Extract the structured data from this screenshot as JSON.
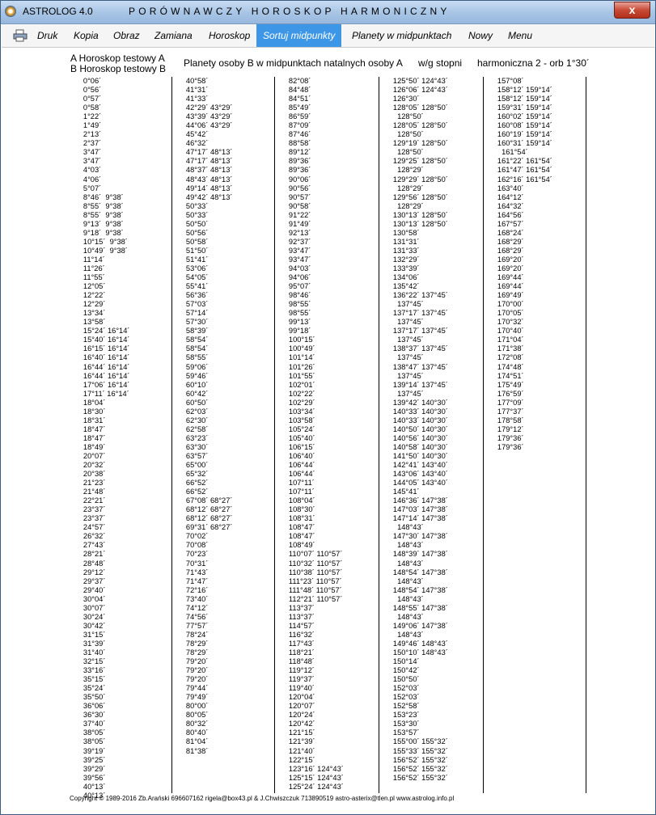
{
  "window": {
    "app_title": "ASTROLOG 4.0",
    "doc_title": "PORÓWNAWCZY HOROSKOP HARMONICZNY",
    "close_label": "x"
  },
  "menu": {
    "items": [
      "Druk",
      "Kopia",
      "Obraz",
      "Zamiana",
      "Horoskop",
      "Sortuj midpunkty",
      "Planety w midpunktach",
      "Nowy",
      "Menu"
    ],
    "active": "Sortuj midpunkty"
  },
  "header": {
    "chart_a": "A Horoskop testowy A",
    "chart_b": "B Horoskop testowy B",
    "description": "Planety osoby B w midpunktach natalnych osoby A",
    "sort": "w/g stopni",
    "harmonic": "harmoniczna 2 - orb 1°30´"
  },
  "columns": {
    "c1": [
      "0°06´",
      "0°56´",
      "0°57´",
      "0°58´",
      "1°22´",
      "1°49´",
      "2°13´",
      "2°37´",
      "3°47´",
      "3°47´",
      "4°03´",
      "4°06´",
      "5°07´",
      "8°46´  9°38´",
      "8°55´  9°38´",
      "8°55´  9°38´",
      "9°13´  9°38´",
      "9°18´  9°38´",
      "10°15´  9°38´",
      "10°49´  9°38´",
      "11°14´",
      "11°26´",
      "11°55´",
      "12°05´",
      "12°22´",
      "12°29´",
      "13°34´",
      "13°58´",
      "15°24´ 16°14´",
      "15°40´ 16°14´",
      "16°15´ 16°14´",
      "16°40´ 16°14´",
      "16°44´ 16°14´",
      "16°44´ 16°14´",
      "17°06´ 16°14´",
      "17°11´ 16°14´",
      "18°04´",
      "18°30´",
      "18°31´",
      "18°47´",
      "18°47´",
      "18°49´",
      "20°07´",
      "20°32´",
      "20°38´",
      "21°23´",
      "21°48´",
      "22°21´",
      "23°37´",
      "23°37´",
      "24°57´",
      "26°32´",
      "27°43´",
      "28°21´",
      "28°48´",
      "29°12´",
      "29°37´",
      "29°40´",
      "30°04´",
      "30°07´",
      "30°24´",
      "30°42´",
      "31°15´",
      "31°39´",
      "31°40´",
      "32°15´",
      "33°16´",
      "35°15´",
      "35°24´",
      "35°50´",
      "36°06´",
      "36°30´",
      "37°40´",
      "38°05´",
      "38°05´",
      "39°19´",
      "39°25´",
      "39°29´",
      "39°56´",
      "40°13´",
      "40°13´"
    ],
    "c2": [
      "40°58´",
      "41°31´",
      "41°33´",
      "42°29´ 43°29´",
      "43°39´ 43°29´",
      "44°06´ 43°29´",
      "45°42´",
      "46°32´",
      "47°17´ 48°13´",
      "47°17´ 48°13´",
      "48°37´ 48°13´",
      "48°43´ 48°13´",
      "49°14´ 48°13´",
      "49°42´ 48°13´",
      "50°33´",
      "50°33´",
      "50°50´",
      "50°56´",
      "50°58´",
      "51°50´",
      "51°41´",
      "53°06´",
      "54°05´",
      "55°41´",
      "56°36´",
      "57°03´",
      "57°14´",
      "57°30´",
      "58°39´",
      "58°54´",
      "58°54´",
      "58°55´",
      "59°06´",
      "59°46´",
      "60°10´",
      "60°42´",
      "60°50´",
      "62°03´",
      "62°30´",
      "62°58´",
      "63°23´",
      "63°30´",
      "63°57´",
      "65°00´",
      "65°32´",
      "66°52´",
      "66°52´",
      "67°08´ 68°27´",
      "68°12´ 68°27´",
      "68°12´ 68°27´",
      "69°31´ 68°27´",
      "70°02´",
      "70°08´",
      "70°23´",
      "70°31´",
      "71°43´",
      "71°47´",
      "72°16´",
      "73°40´",
      "74°12´",
      "74°56´",
      "77°57´",
      "78°24´",
      "78°29´",
      "78°29´",
      "79°20´",
      "79°20´",
      "79°20´",
      "79°44´",
      "79°49´",
      "80°00´",
      "80°05´",
      "80°32´",
      "80°40´",
      "81°04´",
      "81°38´"
    ],
    "c3": [
      "82°08´",
      "84°48´",
      "84°51´",
      "85°49´",
      "86°59´",
      "87°09´",
      "87°46´",
      "88°58´",
      "89°12´",
      "89°36´",
      "89°36´",
      "90°06´",
      "90°56´",
      "90°57´",
      "90°58´",
      "91°22´",
      "91°49´",
      "92°13´",
      "92°37´",
      "93°47´",
      "93°47´",
      "94°03´",
      "94°06´",
      "95°07´",
      "98°46´",
      "98°55´",
      "98°55´",
      "99°13´",
      "99°18´",
      "100°15´",
      "100°49´",
      "101°14´",
      "101°26´",
      "101°55´",
      "102°01´",
      "102°22´",
      "102°29´",
      "103°34´",
      "103°58´",
      "105°24´",
      "105°40´",
      "106°15´",
      "106°40´",
      "106°44´",
      "106°44´",
      "107°11´",
      "107°11´",
      "108°04´",
      "108°30´",
      "108°31´",
      "108°47´",
      "108°47´",
      "108°49´",
      "110°07´ 110°57´",
      "110°32´ 110°57´",
      "110°38´ 110°57´",
      "111°23´ 110°57´",
      "111°48´ 110°57´",
      "112°21´ 110°57´",
      "113°37´",
      "113°37´",
      "114°57´",
      "116°32´",
      "117°43´",
      "118°21´",
      "118°48´",
      "119°12´",
      "119°37´",
      "119°40´",
      "120°04´",
      "120°07´",
      "120°24´",
      "120°42´",
      "121°15´",
      "121°39´",
      "121°40´",
      "122°15´",
      "123°16´ 124°43´",
      "125°15´ 124°43´",
      "125°24´ 124°43´"
    ],
    "c4": [
      "125°50´ 124°43´",
      "126°06´ 124°43´",
      "126°30´",
      "128°05´ 128°50´",
      "  128°50´",
      "128°05´ 128°50´",
      "  128°50´",
      "129°19´ 128°50´",
      "  128°50´",
      "129°25´ 128°50´",
      "  128°29´",
      "129°29´ 128°50´",
      "  128°29´",
      "129°56´ 128°50´",
      "  128°29´",
      "130°13´ 128°50´",
      "130°13´ 128°50´",
      "130°58´",
      "131°31´",
      "131°33´",
      "132°29´",
      "133°39´",
      "134°06´",
      "135°42´",
      "136°22´ 137°45´",
      "  137°45´",
      "137°17´ 137°45´",
      "  137°45´",
      "137°17´ 137°45´",
      "  137°45´",
      "138°37´ 137°45´",
      "  137°45´",
      "138°47´ 137°45´",
      "  137°45´",
      "139°14´ 137°45´",
      "  137°45´",
      "139°42´ 140°30´",
      "140°33´ 140°30´",
      "140°33´ 140°30´",
      "140°50´ 140°30´",
      "140°56´ 140°30´",
      "140°58´ 140°30´",
      "141°50´ 140°30´",
      "142°41´ 143°40´",
      "143°06´ 143°40´",
      "144°05´ 143°40´",
      "145°41´",
      "146°36´ 147°38´",
      "147°03´ 147°38´",
      "147°14´ 147°38´",
      "  148°43´",
      "147°30´ 147°38´",
      "  148°43´",
      "148°39´ 147°38´",
      "  148°43´",
      "148°54´ 147°38´",
      "  148°43´",
      "148°54´ 147°38´",
      "  148°43´",
      "148°55´ 147°38´",
      "  148°43´",
      "149°06´ 147°38´",
      "  148°43´",
      "149°46´ 148°43´",
      "150°10´ 148°43´",
      "150°14´",
      "150°42´",
      "150°50´",
      "152°03´",
      "152°03´",
      "152°58´",
      "153°23´",
      "153°30´",
      "153°57´",
      "155°00´ 155°32´",
      "155°33´ 155°32´",
      "156°52´ 155°32´",
      "156°52´ 155°32´",
      "156°52´ 155°32´"
    ],
    "c5": [
      "157°08´",
      "158°12´ 159°14´",
      "158°12´ 159°14´",
      "159°31´ 159°14´",
      "160°02´ 159°14´",
      "160°08´ 159°14´",
      "160°19´ 159°14´",
      "160°31´ 159°14´",
      "  161°54´",
      "161°22´ 161°54´",
      "161°47´ 161°54´",
      "162°16´ 161°54´",
      "163°40´",
      "164°12´",
      "164°32´",
      "164°56´",
      "167°57´",
      "168°24´",
      "168°29´",
      "168°29´",
      "169°20´",
      "169°20´",
      "169°44´",
      "169°44´",
      "169°49´",
      "170°00´",
      "170°05´",
      "170°32´",
      "170°40´",
      "171°04´",
      "171°38´",
      "172°08´",
      "174°48´",
      "174°51´",
      "175°49´",
      "176°59´",
      "177°09´",
      "177°37´",
      "178°58´",
      "179°12´",
      "179°36´",
      "179°36´"
    ]
  },
  "footer": {
    "copyright": "Copyright © 1989-2016 Zb.Arański 696607162 rigela@box43.pl & J.Chwiszczuk 713890519 astro-asterix@tlen.pl www.astrolog.info.pl"
  }
}
